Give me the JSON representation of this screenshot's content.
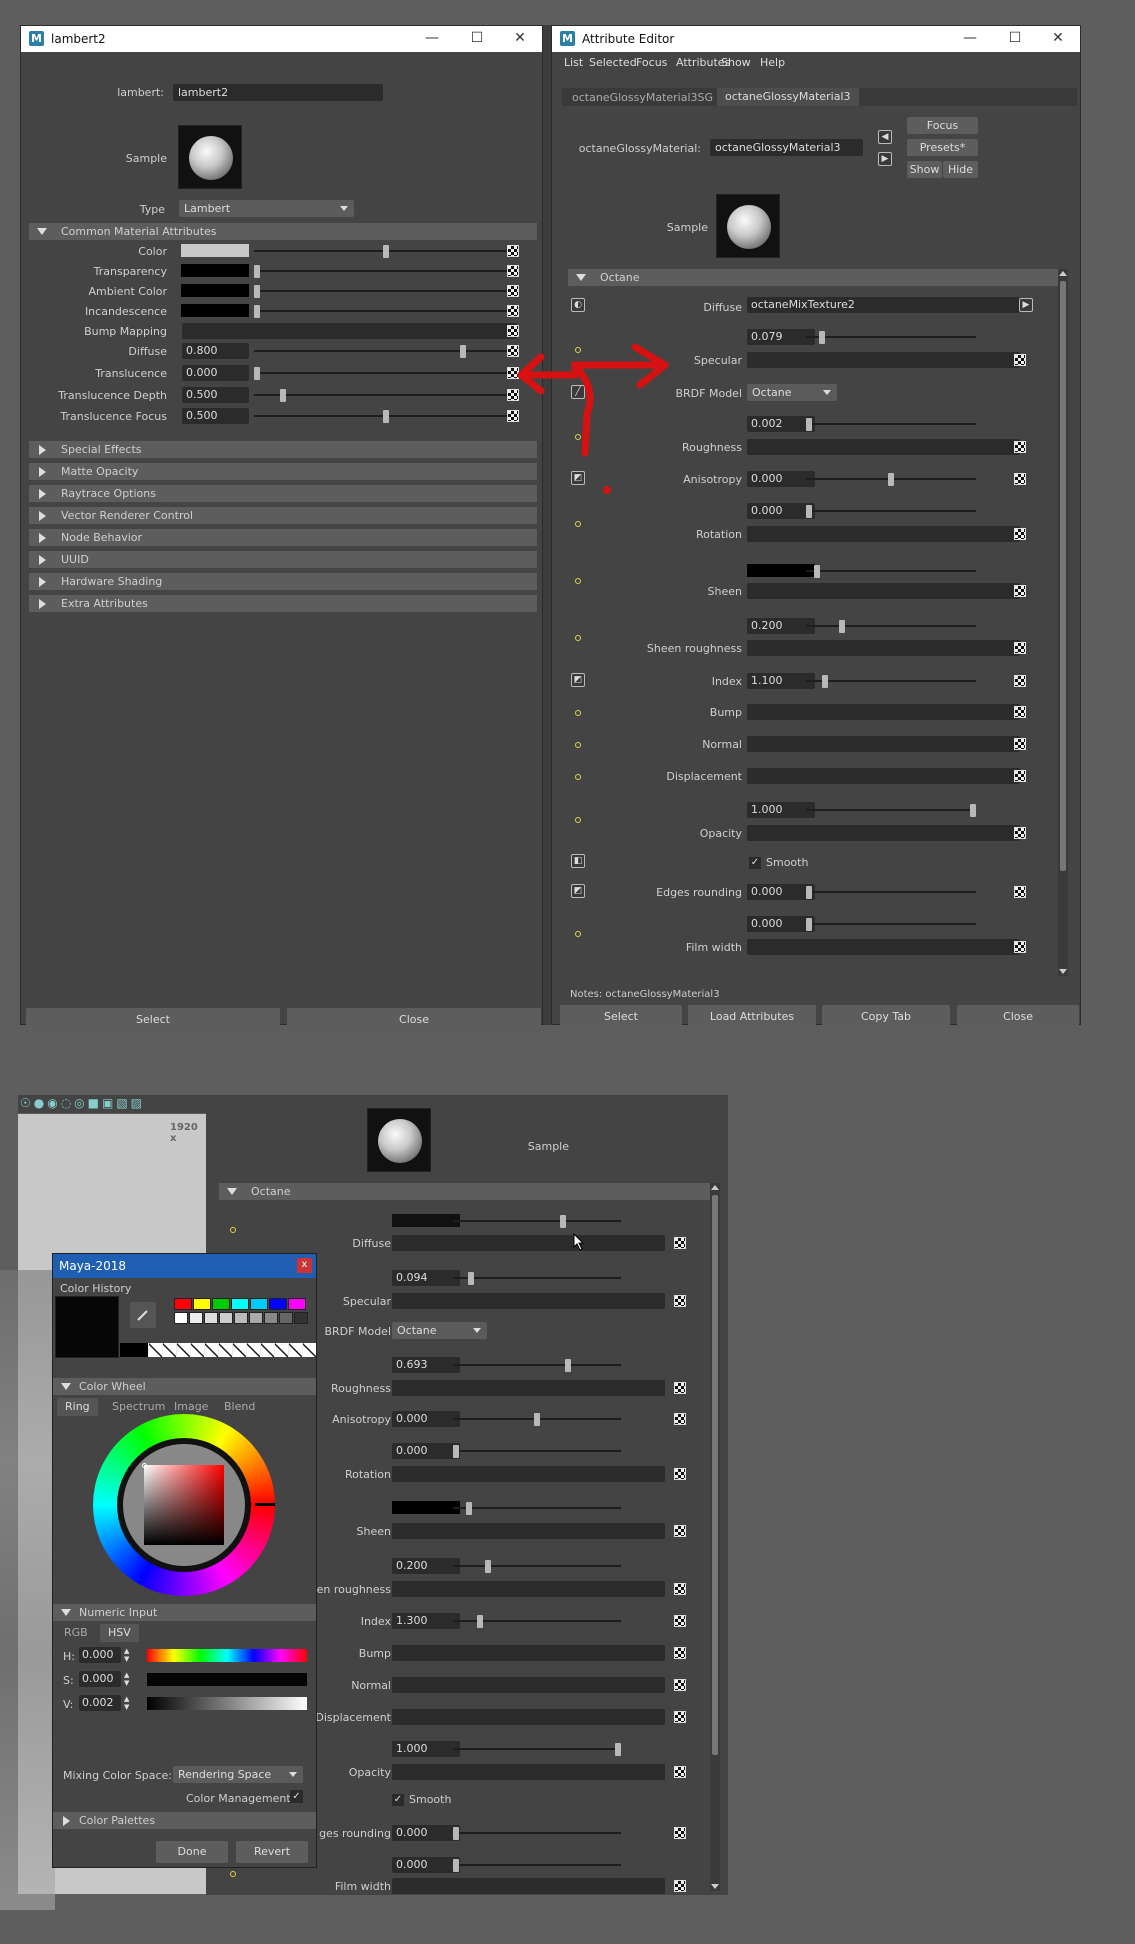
{
  "lambert_window": {
    "title": "lambert2",
    "name_label": "lambert:",
    "name_value": "lambert2",
    "sample_label": "Sample",
    "type_label": "Type",
    "type_value": "Lambert",
    "common_section": "Common Material Attributes",
    "attributes": [
      {
        "label": "Color",
        "kind": "swatch",
        "color": "#c8c8c8",
        "level": 0.5
      },
      {
        "label": "Transparency",
        "kind": "swatch",
        "color": "#000000",
        "level": 0
      },
      {
        "label": "Ambient Color",
        "kind": "swatch",
        "color": "#000000",
        "level": 0
      },
      {
        "label": "Incandescence",
        "kind": "swatch",
        "color": "#000000",
        "level": 0
      },
      {
        "label": "Bump Mapping",
        "kind": "empty"
      },
      {
        "label": "Diffuse",
        "kind": "value",
        "value": "0.800",
        "level": 0.8
      },
      {
        "label": "Translucence",
        "kind": "value",
        "value": "0.000",
        "level": 0
      },
      {
        "label": "Translucence Depth",
        "kind": "value",
        "value": "0.500",
        "level": 0.1
      },
      {
        "label": "Translucence Focus",
        "kind": "value",
        "value": "0.500",
        "level": 0.5
      }
    ],
    "collapsed_sections": [
      "Special Effects",
      "Matte Opacity",
      "Raytrace Options",
      "Vector Renderer Control",
      "Node Behavior",
      "UUID",
      "Hardware Shading",
      "Extra Attributes"
    ],
    "select_button": "Select",
    "close_button": "Close"
  },
  "attr_editor": {
    "title": "Attribute Editor",
    "menu": [
      "List",
      "Selected",
      "Focus",
      "Attributes",
      "Show",
      "Help"
    ],
    "tabs": [
      "octaneGlossyMaterial3SG",
      "octaneGlossyMaterial3"
    ],
    "node_label": "octaneGlossyMaterial:",
    "node_value": "octaneGlossyMaterial3",
    "focus_button": "Focus",
    "presets_button": "Presets*",
    "show_button": "Show",
    "hide_button": "Hide",
    "sample_label": "Sample",
    "section": "Octane",
    "diffuse_label": "Diffuse",
    "diffuse_value": "octaneMixTexture2",
    "specular_value": "0.079",
    "specular_level": 0.079,
    "specular_label": "Specular",
    "brdf_label": "BRDF Model",
    "brdf_value": "Octane",
    "roughness_value": "0.002",
    "roughness_level": 0.002,
    "roughness_label": "Roughness",
    "anisotropy_label": "Anisotropy",
    "anisotropy_value": "0.000",
    "anisotropy_level": 0.5,
    "rotation_value": "0.000",
    "rotation_level": 0,
    "rotation_label": "Rotation",
    "sheen_label": "Sheen",
    "sheen_roughness_value": "0.200",
    "sheen_roughness_level": 0.2,
    "sheen_roughness_label": "Sheen roughness",
    "index_label": "Index",
    "index_value": "1.100",
    "index_level": 0.1,
    "bump_label": "Bump",
    "normal_label": "Normal",
    "displacement_label": "Displacement",
    "opacity_value": "1.000",
    "opacity_level": 1.0,
    "opacity_label": "Opacity",
    "smooth_label": "Smooth",
    "edges_label": "Edges rounding",
    "edges_value": "0.000",
    "film_value": "0.000",
    "film_label": "Film width",
    "notes_label": "Notes:  octaneGlossyMaterial3",
    "buttons": [
      "Select",
      "Load Attributes",
      "Copy Tab",
      "Close"
    ]
  },
  "lower_panel": {
    "resolution_text": "1920 x",
    "sample_label": "Sample",
    "section": "Octane",
    "diffuse_label": "Diffuse",
    "diffuse_level": 0.66,
    "specular_value": "0.094",
    "specular_level": 0.094,
    "specular_label": "Specular",
    "brdf_label": "BRDF Model",
    "brdf_value": "Octane",
    "roughness_value": "0.693",
    "roughness_level": 0.693,
    "roughness_label": "Roughness",
    "anisotropy_label": "Anisotropy",
    "anisotropy_value": "0.000",
    "anisotropy_level": 0.5,
    "rotation_value": "0.000",
    "rotation_label": "Rotation",
    "sheen_label": "Sheen",
    "sheen_roughness_value": "0.200",
    "sheen_roughness_level": 0.2,
    "sheen_roughness_label": "en roughness",
    "index_label": "Index",
    "index_value": "1.300",
    "index_level": 0.15,
    "bump_label": "Bump",
    "normal_label": "Normal",
    "displacement_label": "Displacement",
    "opacity_value": "1.000",
    "opacity_label": "Opacity",
    "smooth_label": "Smooth",
    "edges_label": "ges rounding",
    "edges_value": "0.000",
    "film_value": "0.000",
    "film_label": "Film width"
  },
  "color_picker": {
    "title": "Maya-2018",
    "close": "x",
    "history_label": "Color History",
    "palette_colors": [
      "#ff0000",
      "#ffff00",
      "#00cc00",
      "#00ffff",
      "#00ccff",
      "#0000ff",
      "#ff00ff"
    ],
    "wheel_section": "Color Wheel",
    "wheel_tabs": [
      "Ring",
      "Spectrum",
      "Image",
      "Blend"
    ],
    "numeric_section": "Numeric Input",
    "numeric_tabs": [
      "RGB",
      "HSV"
    ],
    "h_label": "H:",
    "h_value": "0.000",
    "s_label": "S:",
    "s_value": "0.000",
    "v_label": "V:",
    "v_value": "0.002",
    "mixing_label": "Mixing Color Space:",
    "mixing_value": "Rendering Space",
    "color_mgmt_label": "Color Management",
    "palettes_section": "Color Palettes",
    "done_button": "Done",
    "revert_button": "Revert"
  }
}
